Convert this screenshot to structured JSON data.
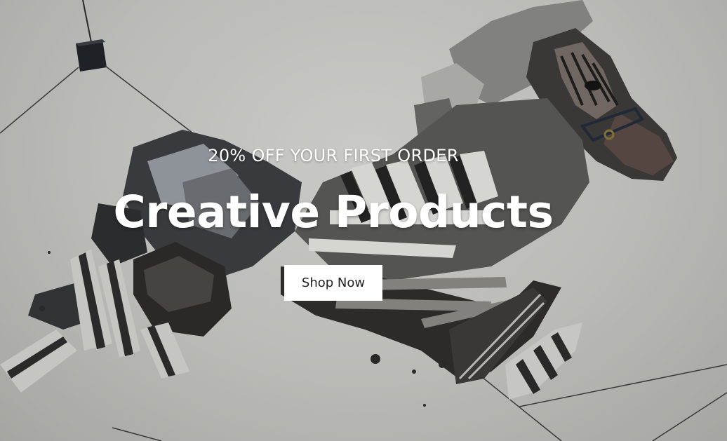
{
  "hero": {
    "promo_text": "20% OFF YOUR FIRST ORDER",
    "headline": "Creative Products",
    "cta_label": "Shop Now",
    "background_subject": "zebra-collage-image"
  },
  "colors": {
    "background": "#cbcbc8",
    "text": "#ffffff",
    "button_bg": "#ffffff",
    "button_text": "#222222"
  }
}
